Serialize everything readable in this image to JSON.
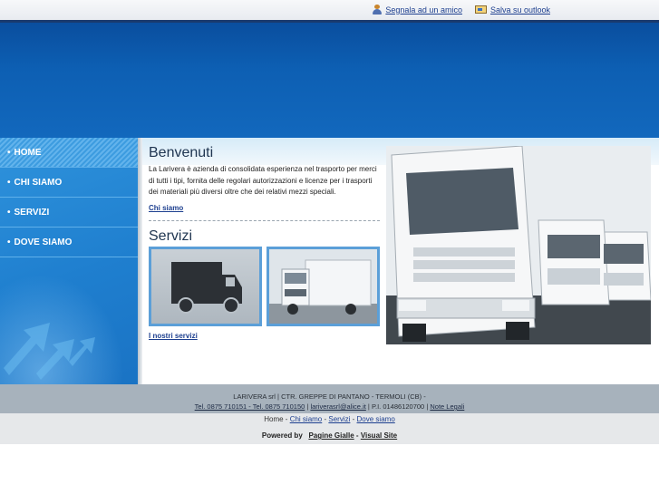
{
  "topbar": {
    "send_friend": "Segnala ad un amico",
    "save_outlook": "Salva su outlook"
  },
  "nav": {
    "items": [
      {
        "label": "HOME",
        "active": true
      },
      {
        "label": "CHI SIAMO"
      },
      {
        "label": "SERVIZI"
      },
      {
        "label": "DOVE SIAMO"
      }
    ]
  },
  "welcome": {
    "title": "Benvenuti",
    "text": "La Larivera è azienda di consolidata esperienza nel trasporto per merci di tutti i tipi, fornita delle regolari autorizzazioni e licenze per i trasporti dei materiali più diversi oltre che dei relativi mezzi speciali.",
    "link": "Chi siamo"
  },
  "services": {
    "title": "Servizi",
    "link": "I nostri servizi"
  },
  "footer": {
    "company": "LARIVERA srl | CTR. GREPPE DI PANTANO - TERMOLI (CB) -",
    "phones": "Tel. 0875 710151 - Tel. 0875 710150",
    "email": "lariverasrl@alice.it",
    "vat": "P.I. 01486120700",
    "legal": "Note Legali",
    "nav": [
      "Home",
      "Chi siamo",
      "Servizi",
      "Dove siamo"
    ],
    "powered_by": "Powered by",
    "pagine_gialle": "Pagine Gialle",
    "visual_site": "Visual Site"
  },
  "colors": {
    "header_blue": "#0d5fb3",
    "sidebar_blue": "#1f7fcf",
    "footer_gray": "#a7b2bc",
    "link_blue": "#1d3f8f"
  }
}
